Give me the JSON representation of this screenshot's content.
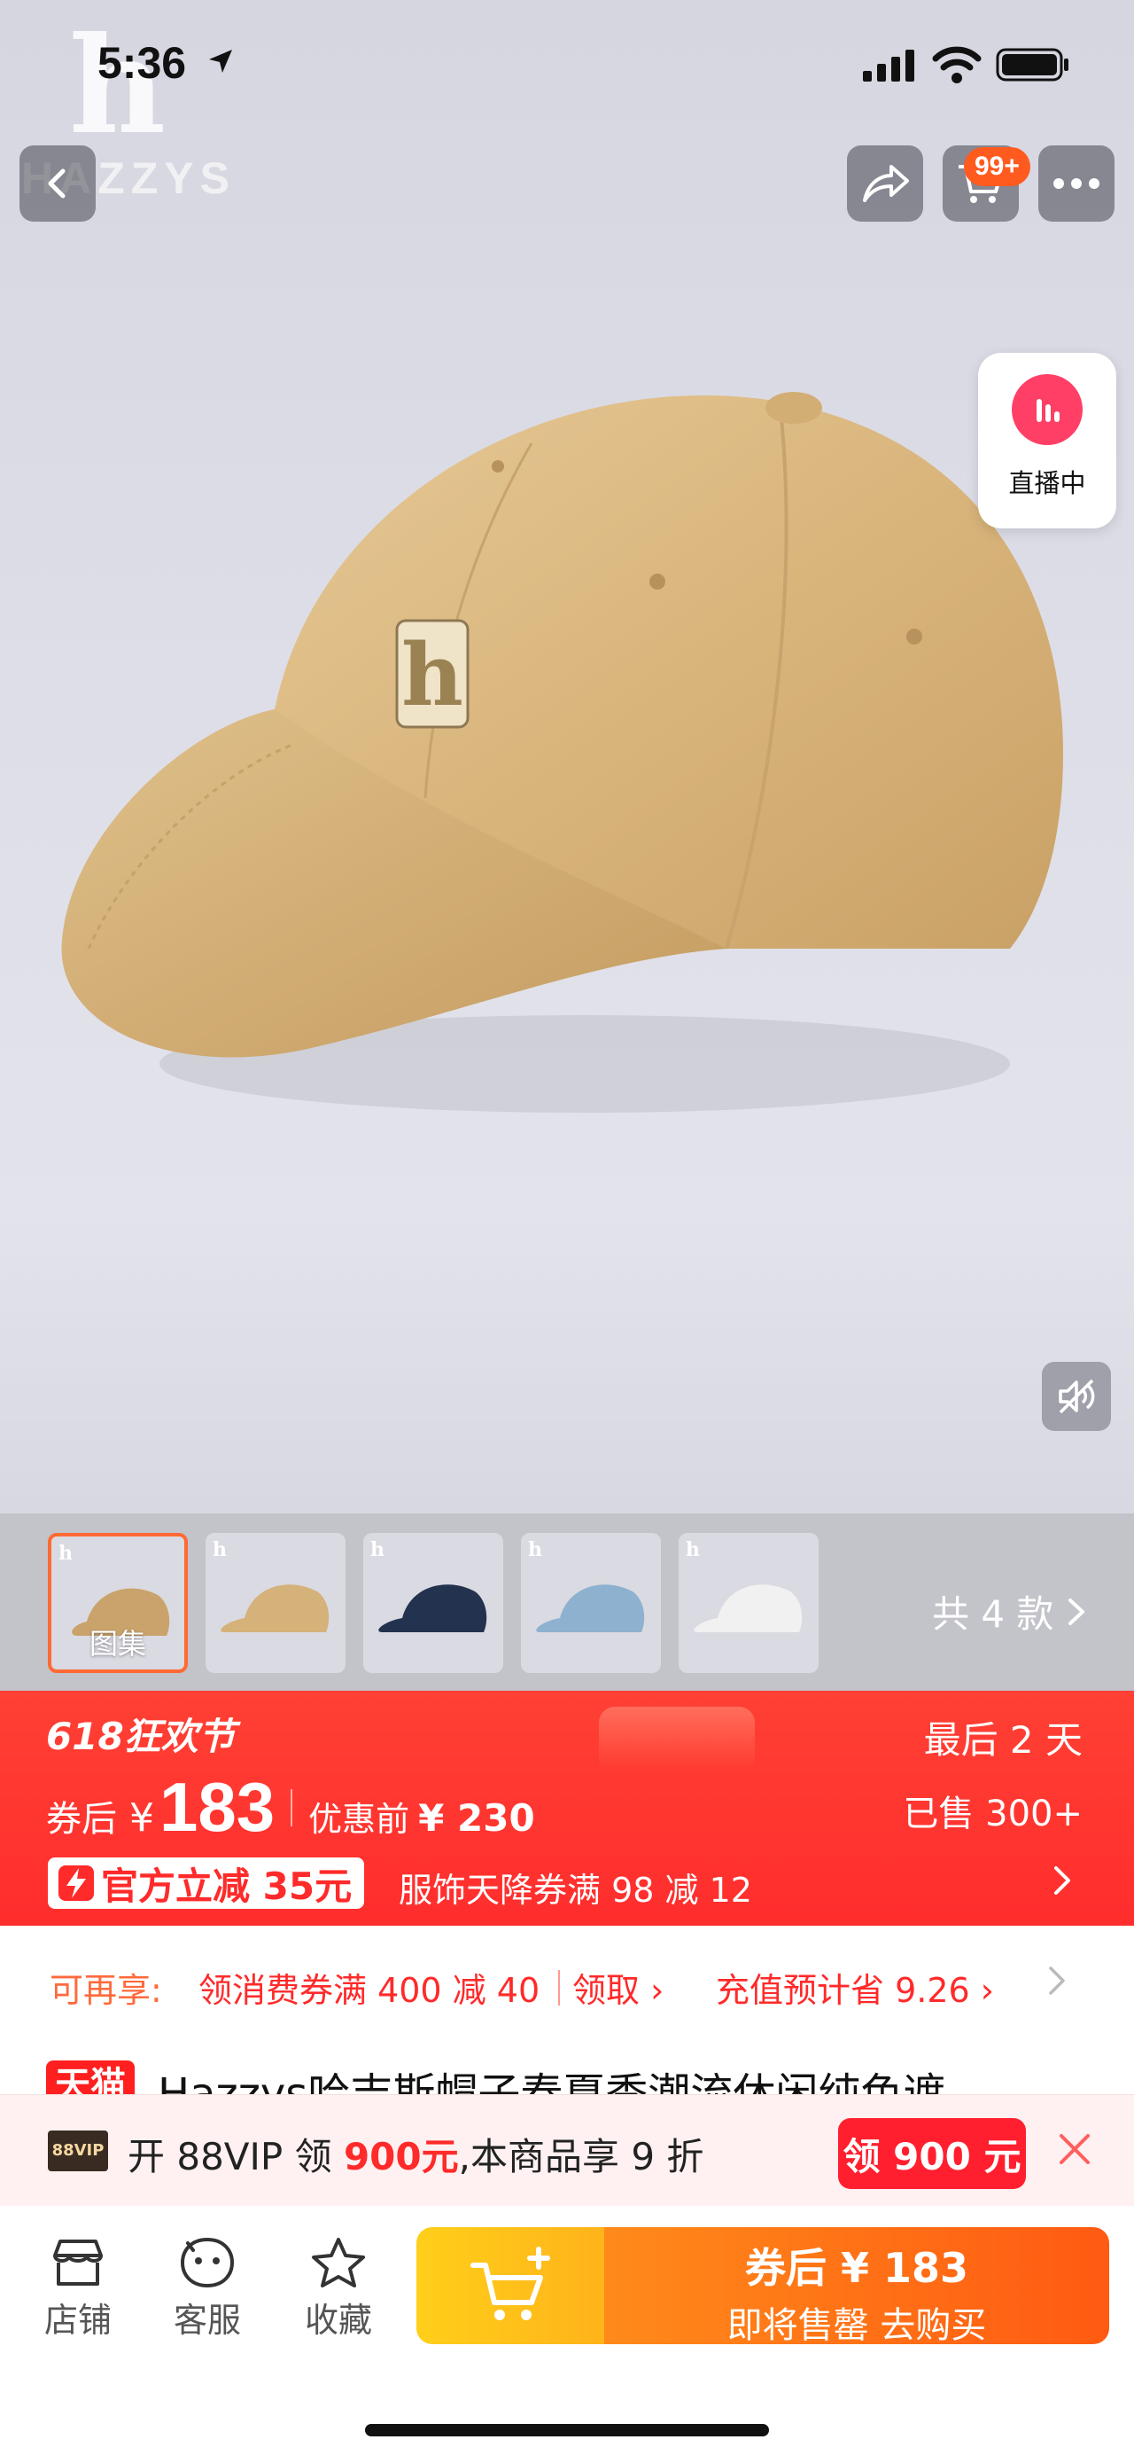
{
  "status_bar": {
    "time": "5:36"
  },
  "brand": {
    "logo_letter": "h",
    "logo_word": "HAZZYS"
  },
  "header": {
    "cart_badge": "99+"
  },
  "live": {
    "label": "直播中"
  },
  "thumbnails": {
    "items": [
      {
        "caption": "图集",
        "color": "#c9a36b"
      },
      {
        "caption": "",
        "color": "#d4b27a"
      },
      {
        "caption": "",
        "color": "#23324f"
      },
      {
        "caption": "",
        "color": "#8eb1cf"
      },
      {
        "caption": "",
        "color": "#f1f1f1"
      }
    ],
    "variants_label": "共 4 款"
  },
  "promo": {
    "festival": "618狂欢节",
    "days_left": "最后 2 天",
    "after_coupon_label": "券后",
    "currency": "¥",
    "price": "183",
    "before_label": "优惠前",
    "before_price": "¥ 230",
    "sold": "已售 300+",
    "official_discount": "官方立减 35元",
    "coupon_desc": "服饰天降券满 98 减 12"
  },
  "extra_coupons": {
    "label": "可再享:",
    "coupon": "领消费券满 400 减 40",
    "claim": "领取",
    "recharge": "充值预计省 9.26"
  },
  "product": {
    "store_tag": "天猫",
    "title": "Hazzys哈吉斯帽子春夏季潮流休闲纯色遮"
  },
  "vip": {
    "tag": "88VIP",
    "text_pre": "开 88VIP 领 ",
    "amount": "900元",
    "text_post": ",本商品享 9 折",
    "button": "领 900 元"
  },
  "bottom_bar": {
    "store": "店铺",
    "service": "客服",
    "favorite": "收藏",
    "buy_line1": "券后 ¥ 183",
    "buy_line2": "即将售罄  去购买"
  },
  "colors": {
    "accent_red": "#ff2d2d",
    "accent_orange": "#ff6a1a",
    "cap_khaki": "#d8b57e"
  }
}
